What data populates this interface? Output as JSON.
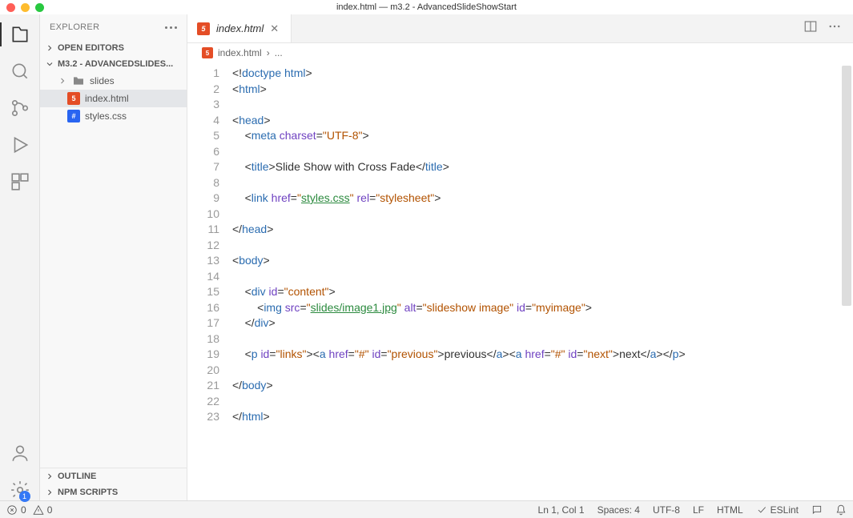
{
  "window_title": "index.html — m3.2 - AdvancedSlideShowStart",
  "sidebar": {
    "title": "EXPLORER",
    "sections": {
      "open_editors": "OPEN EDITORS",
      "project": "M3.2 - ADVANCEDSLIDES...",
      "outline": "OUTLINE",
      "npm": "NPM SCRIPTS"
    },
    "tree": {
      "folder_slides": "slides",
      "file_index": "index.html",
      "file_styles": "styles.css"
    }
  },
  "tab": {
    "label": "index.html"
  },
  "breadcrumb": {
    "file": "index.html",
    "sep": "›",
    "more": "..."
  },
  "code_lines": [
    {
      "n": 1,
      "html": "<span class='t-pun'>&lt;!</span><span class='t-doct'>doctype</span> <span class='t-tag'>html</span><span class='t-pun'>&gt;</span>"
    },
    {
      "n": 2,
      "html": "<span class='t-pun'>&lt;</span><span class='t-tag'>html</span><span class='t-pun'>&gt;</span>"
    },
    {
      "n": 3,
      "html": ""
    },
    {
      "n": 4,
      "html": "<span class='t-pun'>&lt;</span><span class='t-tag'>head</span><span class='t-pun'>&gt;</span>"
    },
    {
      "n": 5,
      "html": "    <span class='t-pun'>&lt;</span><span class='t-tag'>meta</span> <span class='t-attr'>charset</span><span class='t-pun'>=</span><span class='t-str'>\"UTF-8\"</span><span class='t-pun'>&gt;</span>"
    },
    {
      "n": 6,
      "html": ""
    },
    {
      "n": 7,
      "html": "    <span class='t-pun'>&lt;</span><span class='t-tag'>title</span><span class='t-pun'>&gt;</span><span class='t-txt'>Slide Show with Cross Fade</span><span class='t-pun'>&lt;/</span><span class='t-tag'>title</span><span class='t-pun'>&gt;</span>"
    },
    {
      "n": 8,
      "html": ""
    },
    {
      "n": 9,
      "html": "    <span class='t-pun'>&lt;</span><span class='t-tag'>link</span> <span class='t-attr'>href</span><span class='t-pun'>=</span><span class='t-str'>\"<span class='t-link'>styles.css</span>\"</span> <span class='t-attr'>rel</span><span class='t-pun'>=</span><span class='t-str'>\"stylesheet\"</span><span class='t-pun'>&gt;</span>"
    },
    {
      "n": 10,
      "html": ""
    },
    {
      "n": 11,
      "html": "<span class='t-pun'>&lt;/</span><span class='t-tag'>head</span><span class='t-pun'>&gt;</span>"
    },
    {
      "n": 12,
      "html": ""
    },
    {
      "n": 13,
      "html": "<span class='t-pun'>&lt;</span><span class='t-tag'>body</span><span class='t-pun'>&gt;</span>"
    },
    {
      "n": 14,
      "html": ""
    },
    {
      "n": 15,
      "html": "    <span class='t-pun'>&lt;</span><span class='t-tag'>div</span> <span class='t-attr'>id</span><span class='t-pun'>=</span><span class='t-str'>\"content\"</span><span class='t-pun'>&gt;</span>"
    },
    {
      "n": 16,
      "html": "        <span class='t-pun'>&lt;</span><span class='t-tag'>img</span> <span class='t-attr'>src</span><span class='t-pun'>=</span><span class='t-str'>\"<span class='t-link'>slides/image1.jpg</span>\"</span> <span class='t-attr'>alt</span><span class='t-pun'>=</span><span class='t-str'>\"slideshow image\"</span> <span class='t-attr'>id</span><span class='t-pun'>=</span><span class='t-str'>\"myimage\"</span><span class='t-pun'>&gt;</span>"
    },
    {
      "n": 17,
      "html": "    <span class='t-pun'>&lt;/</span><span class='t-tag'>div</span><span class='t-pun'>&gt;</span>"
    },
    {
      "n": 18,
      "html": ""
    },
    {
      "n": 19,
      "html": "    <span class='t-pun'>&lt;</span><span class='t-tag'>p</span> <span class='t-attr'>id</span><span class='t-pun'>=</span><span class='t-str'>\"links\"</span><span class='t-pun'>&gt;&lt;</span><span class='t-tag'>a</span> <span class='t-attr'>href</span><span class='t-pun'>=</span><span class='t-str'>\"#\"</span> <span class='t-attr'>id</span><span class='t-pun'>=</span><span class='t-str'>\"previous\"</span><span class='t-pun'>&gt;</span><span class='t-txt'>previous</span><span class='t-pun'>&lt;/</span><span class='t-tag'>a</span><span class='t-pun'>&gt;&lt;</span><span class='t-tag'>a</span> <span class='t-attr'>href</span><span class='t-pun'>=</span><span class='t-str'>\"#\"</span> <span class='t-attr'>id</span><span class='t-pun'>=</span><span class='t-str'>\"next\"</span><span class='t-pun'>&gt;</span><span class='t-txt'>next</span><span class='t-pun'>&lt;/</span><span class='t-tag'>a</span><span class='t-pun'>&gt;&lt;/</span><span class='t-tag'>p</span><span class='t-pun'>&gt;</span>"
    },
    {
      "n": 20,
      "html": ""
    },
    {
      "n": 21,
      "html": "<span class='t-pun'>&lt;/</span><span class='t-tag'>body</span><span class='t-pun'>&gt;</span>"
    },
    {
      "n": 22,
      "html": ""
    },
    {
      "n": 23,
      "html": "<span class='t-pun'>&lt;/</span><span class='t-tag'>html</span><span class='t-pun'>&gt;</span>"
    }
  ],
  "status": {
    "errors": "0",
    "warnings": "0",
    "lncol": "Ln 1, Col 1",
    "spaces": "Spaces: 4",
    "enc": "UTF-8",
    "eol": "LF",
    "lang": "HTML",
    "eslint": "ESLint"
  }
}
